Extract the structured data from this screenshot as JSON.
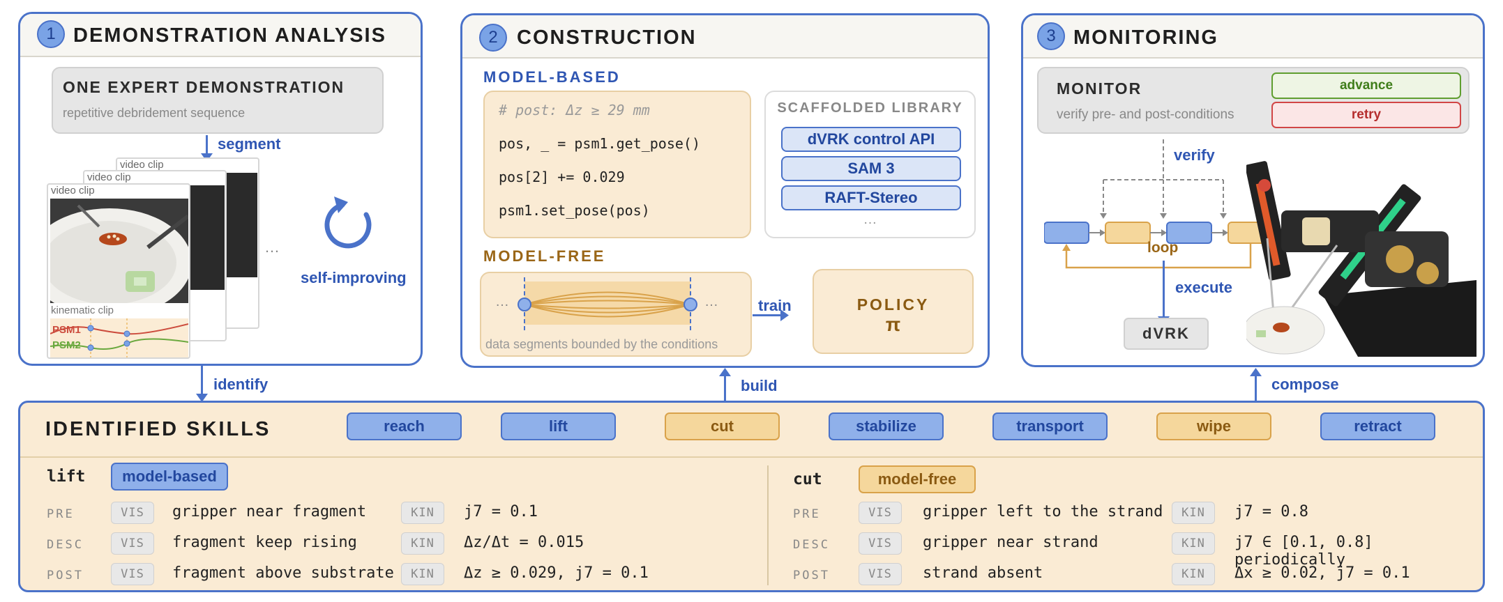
{
  "panel1": {
    "number": "1",
    "title": "DEMONSTRATION ANALYSIS",
    "demo_title": "ONE EXPERT DEMONSTRATION",
    "demo_subtitle": "repetitive debridement sequence",
    "segment_label": "segment",
    "video_clip_label": "video clip",
    "kinematic_clip_label": "kinematic clip",
    "psm1_label": "PSM1",
    "psm2_label": "PSM2",
    "ellipsis": "…",
    "self_improving_label": "self-improving",
    "identify_label": "identify"
  },
  "panel2": {
    "number": "2",
    "title": "CONSTRUCTION",
    "model_based_label": "MODEL-BASED",
    "code_lines": [
      "# post: Δz ≥ 29 mm",
      "pos, _ = psm1.get_pose()",
      "pos[2] += 0.029",
      "psm1.set_pose(pos)"
    ],
    "library_title": "SCAFFOLDED LIBRARY",
    "library_items": [
      "dVRK control API",
      "SAM 3",
      "RAFT-Stereo"
    ],
    "library_more": "…",
    "model_free_label": "MODEL-FREE",
    "segments_caption": "data segments bounded by the conditions",
    "segments_ellipsis_left": "…",
    "segments_ellipsis_right": "…",
    "train_label": "train",
    "policy_label": "POLICY",
    "policy_symbol": "π",
    "build_label": "build"
  },
  "panel3": {
    "number": "3",
    "title": "MONITORING",
    "monitor_title": "MONITOR",
    "monitor_subtitle": "verify pre- and post-conditions",
    "advance_label": "advance",
    "retry_label": "retry",
    "verify_label": "verify",
    "loop_label": "loop",
    "execute_label": "execute",
    "dvrk_label": "dVRK",
    "compose_label": "compose"
  },
  "skills": {
    "title": "IDENTIFIED SKILLS",
    "list": [
      {
        "label": "reach",
        "kind": "model-based"
      },
      {
        "label": "lift",
        "kind": "model-based"
      },
      {
        "label": "cut",
        "kind": "model-free"
      },
      {
        "label": "stabilize",
        "kind": "model-based"
      },
      {
        "label": "transport",
        "kind": "model-based"
      },
      {
        "label": "wipe",
        "kind": "model-free"
      },
      {
        "label": "retract",
        "kind": "model-based"
      }
    ],
    "left": {
      "name": "lift",
      "type": "model-based",
      "rows": [
        {
          "key": "PRE",
          "vis_tag": "VIS",
          "vis": "gripper near fragment",
          "kin_tag": "KIN",
          "kin": "j7 = 0.1"
        },
        {
          "key": "DESC",
          "vis_tag": "VIS",
          "vis": "fragment keep rising",
          "kin_tag": "KIN",
          "kin": "Δz/Δt = 0.015"
        },
        {
          "key": "POST",
          "vis_tag": "VIS",
          "vis": "fragment above substrate",
          "kin_tag": "KIN",
          "kin": "Δz ≥ 0.029, j7 = 0.1"
        }
      ]
    },
    "right": {
      "name": "cut",
      "type": "model-free",
      "rows": [
        {
          "key": "PRE",
          "vis_tag": "VIS",
          "vis": "gripper left to the strand",
          "kin_tag": "KIN",
          "kin": "j7 = 0.8"
        },
        {
          "key": "DESC",
          "vis_tag": "VIS",
          "vis": "gripper near strand",
          "kin_tag": "KIN",
          "kin": "j7 ∈ [0.1, 0.8] periodically"
        },
        {
          "key": "POST",
          "vis_tag": "VIS",
          "vis": "strand absent",
          "kin_tag": "KIN",
          "kin": "Δx ≥ 0.02, j7 = 0.1"
        }
      ]
    }
  },
  "colors": {
    "accent_blue": "#4a72c9",
    "skill_blue": "#8fb0ea",
    "skill_tan": "#f5d79c",
    "advance_green": "#5f9e2f",
    "retry_red": "#d14545"
  }
}
